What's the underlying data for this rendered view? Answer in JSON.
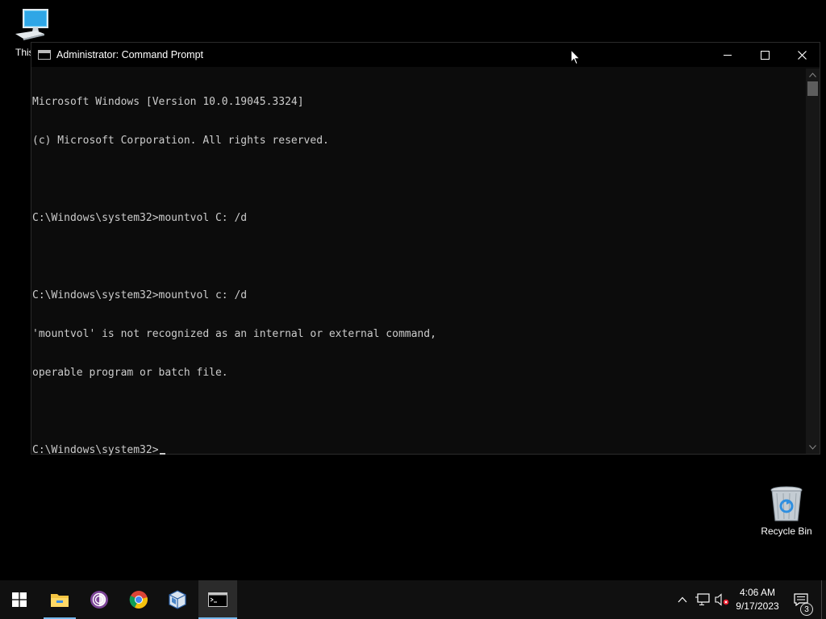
{
  "desktop": {
    "icons": [
      {
        "label": "This PC",
        "icon": "this-pc-icon"
      },
      {
        "label": "Recycle Bin",
        "icon": "recycle-bin-icon"
      }
    ]
  },
  "window": {
    "title": "Administrator: Command Prompt",
    "controls": {
      "minimize": "minimize-icon",
      "maximize": "maximize-icon",
      "close": "close-icon"
    }
  },
  "console": {
    "lines": [
      "Microsoft Windows [Version 10.0.19045.3324]",
      "(c) Microsoft Corporation. All rights reserved.",
      "",
      "C:\\Windows\\system32>mountvol C: /d",
      "",
      "C:\\Windows\\system32>mountvol c: /d",
      "'mountvol' is not recognized as an internal or external command,",
      "operable program or batch file.",
      "",
      "C:\\Windows\\system32>"
    ],
    "text_color": "#cccccc",
    "background": "#0c0c0c"
  },
  "taskbar": {
    "apps": [
      {
        "name": "Start",
        "icon": "windows-start-icon"
      },
      {
        "name": "File Explorer",
        "icon": "file-explorer-icon"
      },
      {
        "name": "Tor Browser",
        "icon": "tor-browser-icon"
      },
      {
        "name": "Google Chrome",
        "icon": "chrome-icon"
      },
      {
        "name": "VirtualBox",
        "icon": "virtualbox-icon"
      },
      {
        "name": "Command Prompt",
        "icon": "command-prompt-icon"
      }
    ],
    "tray": {
      "time": "4:06 AM",
      "date": "9/17/2023",
      "notification_count": "3"
    },
    "accent": "#76b9ed"
  }
}
